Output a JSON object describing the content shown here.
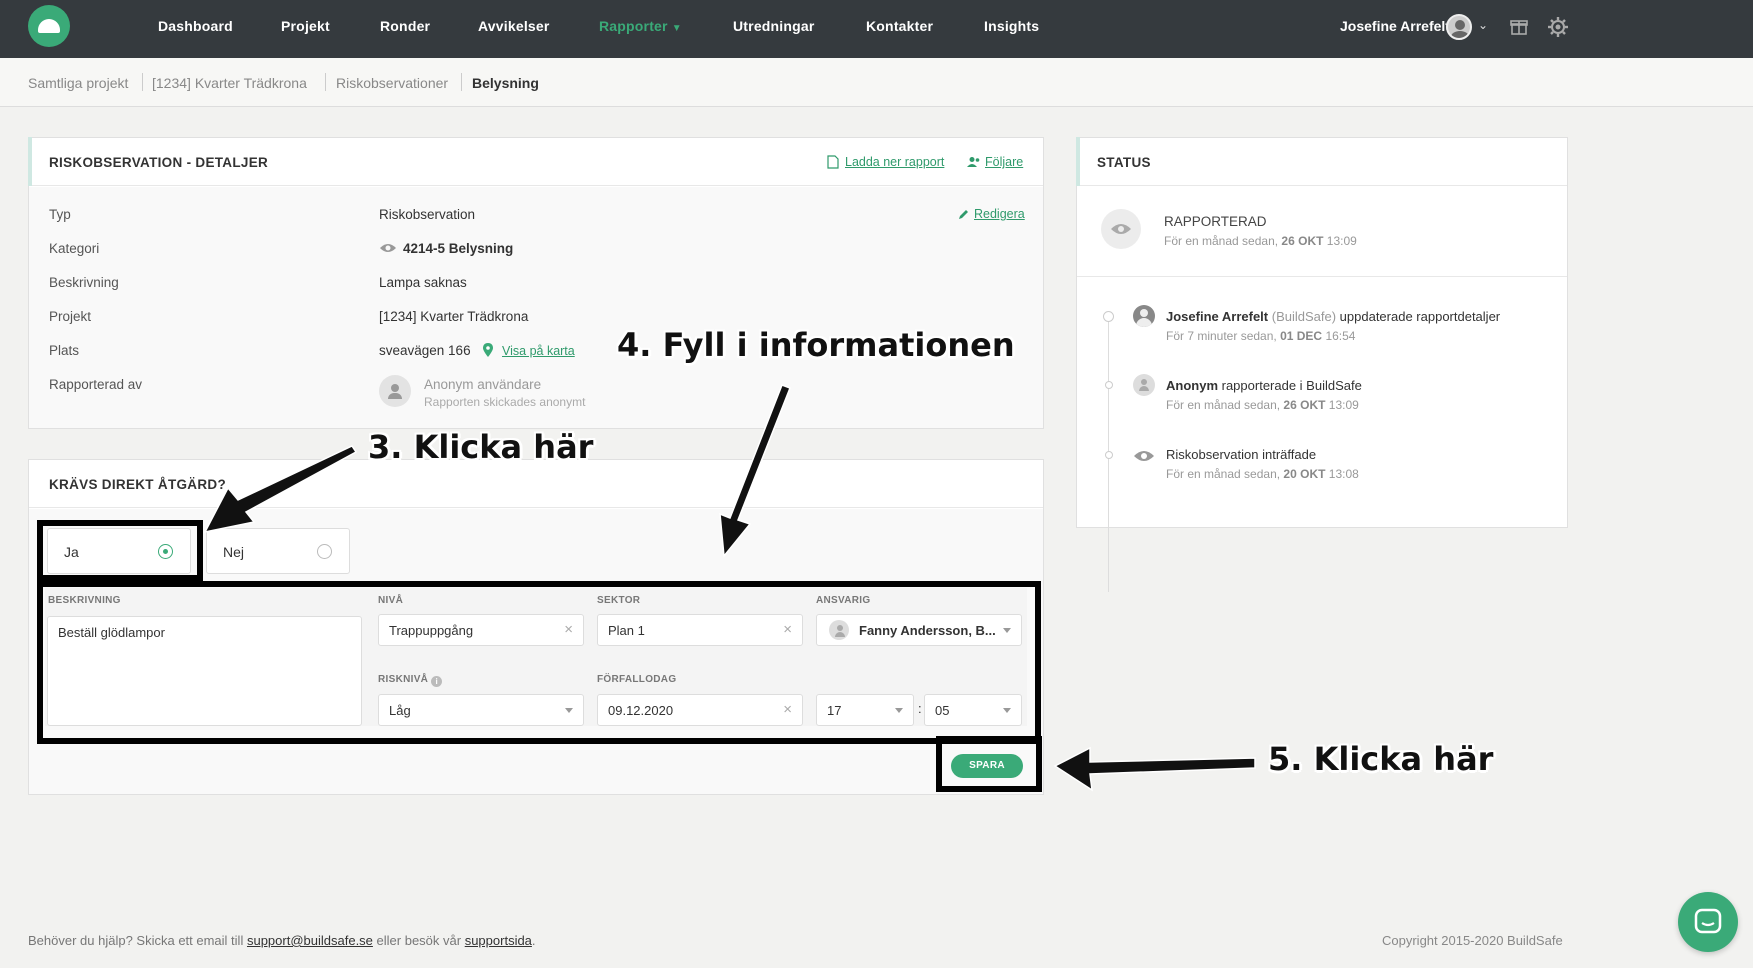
{
  "nav": {
    "items": [
      "Dashboard",
      "Projekt",
      "Ronder",
      "Avvikelser",
      "Rapporter",
      "Utredningar",
      "Kontakter",
      "Insights"
    ],
    "active": "Rapporter",
    "user_name": "Josefine Arrefelt"
  },
  "breadcrumb": [
    "Samtliga projekt",
    "[1234] Kvarter Trädkrona",
    "Riskobservationer",
    "Belysning"
  ],
  "details": {
    "title": "RISKOBSERVATION - DETALJER",
    "download_label": "Ladda ner rapport",
    "followers_label": "Följare",
    "edit_label": "Redigera",
    "rows": {
      "typ_label": "Typ",
      "typ_value": "Riskobservation",
      "kategori_label": "Kategori",
      "kategori_value": "4214-5 Belysning",
      "beskrivning_label": "Beskrivning",
      "beskrivning_value": "Lampa saknas",
      "projekt_label": "Projekt",
      "projekt_value": "[1234] Kvarter Trädkrona",
      "plats_label": "Plats",
      "plats_value": "sveavägen 166",
      "map_link": "Visa på karta",
      "reporter_label": "Rapporterad av",
      "reporter_name": "Anonym användare",
      "reporter_note": "Rapporten skickades anonymt"
    }
  },
  "action": {
    "title": "KRÄVS DIREKT ÅTGÄRD?",
    "yes_label": "Ja",
    "no_label": "Nej",
    "selected": "Ja",
    "fields": {
      "beskrivning_label": "BESKRIVNING",
      "beskrivning_value": "Beställ glödlampor",
      "niva_label": "NIVÅ",
      "niva_value": "Trappuppgång",
      "sektor_label": "SEKTOR",
      "sektor_value": "Plan 1",
      "ansvarig_label": "ANSVARIG",
      "ansvarig_value": "Fanny Andersson, B...",
      "riskniva_label": "RISKNIVÅ",
      "riskniva_value": "Låg",
      "forfallodag_label": "FÖRFALLODAG",
      "forfallodag_value": "09.12.2020",
      "hour_value": "17",
      "minute_value": "05"
    },
    "save_label": "SPARA"
  },
  "status": {
    "title": "STATUS",
    "current": "RAPPORTERAD",
    "current_time_prefix": "För en månad sedan,",
    "current_time_date": "26 OKT",
    "current_time_clock": "13:09",
    "events": [
      {
        "actor": "Josefine Arrefelt",
        "org": "(BuildSafe)",
        "action": "uppdaterade rapportdetaljer",
        "time_prefix": "För 7 minuter sedan,",
        "date": "01 DEC",
        "clock": "16:54"
      },
      {
        "actor": "Anonym",
        "org": "",
        "action": "rapporterade i BuildSafe",
        "time_prefix": "För en månad sedan,",
        "date": "26 OKT",
        "clock": "13:09"
      },
      {
        "actor": "",
        "org": "",
        "action": "Riskobservation inträffade",
        "time_prefix": "För en månad sedan,",
        "date": "20 OKT",
        "clock": "13:08"
      }
    ]
  },
  "annotations": {
    "step3": "3. Klicka här",
    "step4": "4. Fyll i informationen",
    "step5": "5. Klicka här"
  },
  "footer": {
    "help_prefix": "Behöver du hjälp? Skicka ett email till",
    "email": "support@buildsafe.se",
    "help_middle": "eller besök vår",
    "support_link": "supportsida",
    "copyright": "Copyright 2015-2020 BuildSafe"
  },
  "colors": {
    "brand_green": "#3aaa78",
    "nav_bg": "#353a3e"
  }
}
